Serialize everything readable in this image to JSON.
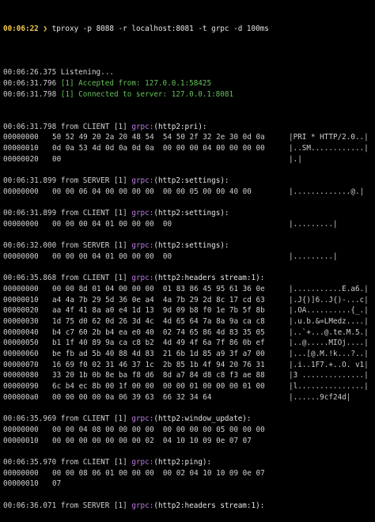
{
  "prompt": {
    "time": "00:06:22",
    "arrow": "❯",
    "command": "tproxy -p 8088 -r localhost:8081 -t grpc -d 100ms"
  },
  "status_lines": [
    {
      "time": "00:06:26.375",
      "text": "Listening...",
      "color": "#d6d6d6"
    },
    {
      "time": "00:06:31.796",
      "text": "[1] Accepted from: 127.0.0.1:58425",
      "color": "#66c05a"
    },
    {
      "time": "00:06:31.798",
      "text": "[1] Connected to server: 127.0.0.1:8081",
      "color": "#66c05a"
    }
  ],
  "blocks": [
    {
      "time": "00:06:31.798",
      "source": "from CLIENT [1]",
      "proto": "grpc:",
      "frame": "(http2:pri):",
      "rows": [
        {
          "off": "00000000",
          "hex": "50 52 49 20 2a 20 48 54  54 50 2f 32 2e 30 0d 0a",
          "asc": "|PRI * HTTP/2.0..|"
        },
        {
          "off": "00000010",
          "hex": "0d 0a 53 4d 0d 0a 0d 0a  00 00 00 04 00 00 00 00",
          "asc": "|..SM............|"
        },
        {
          "off": "00000020",
          "hex": "00",
          "asc": "|.|"
        }
      ]
    },
    {
      "time": "00:06:31.899",
      "source": "from SERVER [1]",
      "proto": "grpc:",
      "frame": "(http2:settings):",
      "rows": [
        {
          "off": "00000000",
          "hex": "00 00 06 04 00 00 00 00  00 00 05 00 00 40 00",
          "asc": "|.............@.|"
        }
      ]
    },
    {
      "time": "00:06:31.899",
      "source": "from CLIENT [1]",
      "proto": "grpc:",
      "frame": "(http2:settings):",
      "rows": [
        {
          "off": "00000000",
          "hex": "00 00 00 04 01 00 00 00  00",
          "asc": "|.........|"
        }
      ]
    },
    {
      "time": "00:06:32.000",
      "source": "from SERVER [1]",
      "proto": "grpc:",
      "frame": "(http2:settings):",
      "rows": [
        {
          "off": "00000000",
          "hex": "00 00 00 04 01 00 00 00  00",
          "asc": "|.........|"
        }
      ]
    },
    {
      "time": "00:06:35.868",
      "source": "from CLIENT [1]",
      "proto": "grpc:",
      "frame": "(http2:headers stream:1):",
      "rows": [
        {
          "off": "00000000",
          "hex": "00 00 8d 01 04 00 00 00  01 83 86 45 95 61 36 0e",
          "asc": "|...........E.a6.|"
        },
        {
          "off": "00000010",
          "hex": "a4 4a 7b 29 5d 36 0e a4  4a 7b 29 2d 8c 17 cd 63",
          "asc": "|.J{)]6..J{)-...c|"
        },
        {
          "off": "00000020",
          "hex": "aa 4f 41 8a a0 e4 1d 13  9d 09 b8 f0 1e 7b 5f 8b",
          "asc": "|.OA..........{_.|"
        },
        {
          "off": "00000030",
          "hex": "1d 75 d0 62 0d 26 3d 4c  4d 65 64 7a 8a 9a ca c8",
          "asc": "|.u.b.&=LMedz....|"
        },
        {
          "off": "00000040",
          "hex": "b4 c7 60 2b b4 ea e0 40  02 74 65 86 4d 83 35 05",
          "asc": "|..`+...@.te.M.5.|"
        },
        {
          "off": "00000050",
          "hex": "b1 1f 40 89 9a ca c8 b2  4d 49 4f 6a 7f 86 0b ef",
          "asc": "|..@.....MIOj....|"
        },
        {
          "off": "00000060",
          "hex": "be fb ad 5b 40 88 4d 83  21 6b 1d 85 a9 3f a7 00",
          "asc": "|...[@.M.!k...?..|"
        },
        {
          "off": "00000070",
          "hex": "16 69 f0 02 31 46 37 1c  2b 85 1b 4f 94 20 76 31",
          "asc": "|.i..1F7.+..O. v1|"
        },
        {
          "off": "00000080",
          "hex": "33 20 1b 0b 8e ba f8 d6  8d a7 84 d8 c8 f3 ae 88",
          "asc": "|3 ..............|"
        },
        {
          "off": "00000090",
          "hex": "6c b4 ec 8b 00 1f 00 00  00 00 01 00 00 00 01 00",
          "asc": "|l...............|"
        },
        {
          "off": "000000a0",
          "hex": "00 00 00 00 0a 06 39 63  66 32 34 64",
          "asc": "|......9cf24d|"
        }
      ]
    },
    {
      "time": "00:06:35.969",
      "source": "from CLIENT [1]",
      "proto": "grpc:",
      "frame": "(http2:window_update):",
      "rows": [
        {
          "off": "00000000",
          "hex": "00 00 04 08 00 00 00 00  00 00 00 00 05 00 00 00",
          "asc": ""
        },
        {
          "off": "00000010",
          "hex": "00 00 00 00 00 00 00 02  04 10 10 09 0e 07 07",
          "asc": ""
        }
      ]
    },
    {
      "time": "00:06:35.970",
      "source": "from CLIENT [1]",
      "proto": "grpc:",
      "frame": "(http2:ping):",
      "rows": [
        {
          "off": "00000000",
          "hex": "00 00 08 06 01 00 00 00  00 02 04 10 10 09 0e 07",
          "asc": ""
        },
        {
          "off": "00000010",
          "hex": "07",
          "asc": ""
        }
      ]
    },
    {
      "time": "00:06:36.071",
      "source": "from SERVER [1]",
      "proto": "grpc:",
      "frame": "(http2:headers stream:1):",
      "rows": []
    }
  ]
}
